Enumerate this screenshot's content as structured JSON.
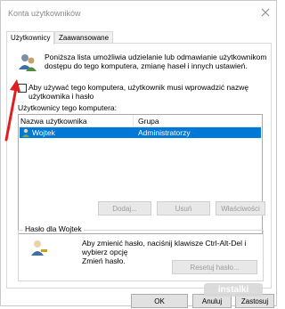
{
  "window": {
    "title": "Konta użytkowników"
  },
  "tabs": [
    {
      "label": "Użytkownicy",
      "active": true
    },
    {
      "label": "Zaawansowane",
      "active": false
    }
  ],
  "intro": {
    "line1": "Poniższa lista umożliwia udzielanie lub odmawianie użytkownikom",
    "line2": "dostępu do tego komputera, zmianę haseł i innych ustawień."
  },
  "require_password": {
    "line1": "Aby używać tego komputera, użytkownik musi wprowadzić nazwę",
    "line2": "użytkownika i hasło",
    "checked": false
  },
  "users_section": {
    "label": "Użytkownicy tego komputera:"
  },
  "user_table": {
    "columns": [
      "Nazwa użytkownika",
      "Grupa"
    ],
    "rows": [
      {
        "name": "Wojtek",
        "group": "Administratorzy",
        "selected": true
      }
    ]
  },
  "user_buttons": {
    "add": "Dodaj...",
    "remove": "Usuń",
    "properties": "Właściwości"
  },
  "password_group": {
    "title": "Hasło dla Wojtek",
    "line1": "Aby zmienić hasło, naciśnij klawisze Ctrl-Alt-Del i wybierz opcję",
    "line2": "Zmień hasło.",
    "reset_button": "Resetuj hasło..."
  },
  "dialog_buttons": {
    "ok": "OK",
    "cancel": "Anuluj",
    "apply": "Zastosuj"
  },
  "watermark": "instalki",
  "colors": {
    "selection": "#0078d7",
    "annotation_arrow": "#e02020"
  }
}
